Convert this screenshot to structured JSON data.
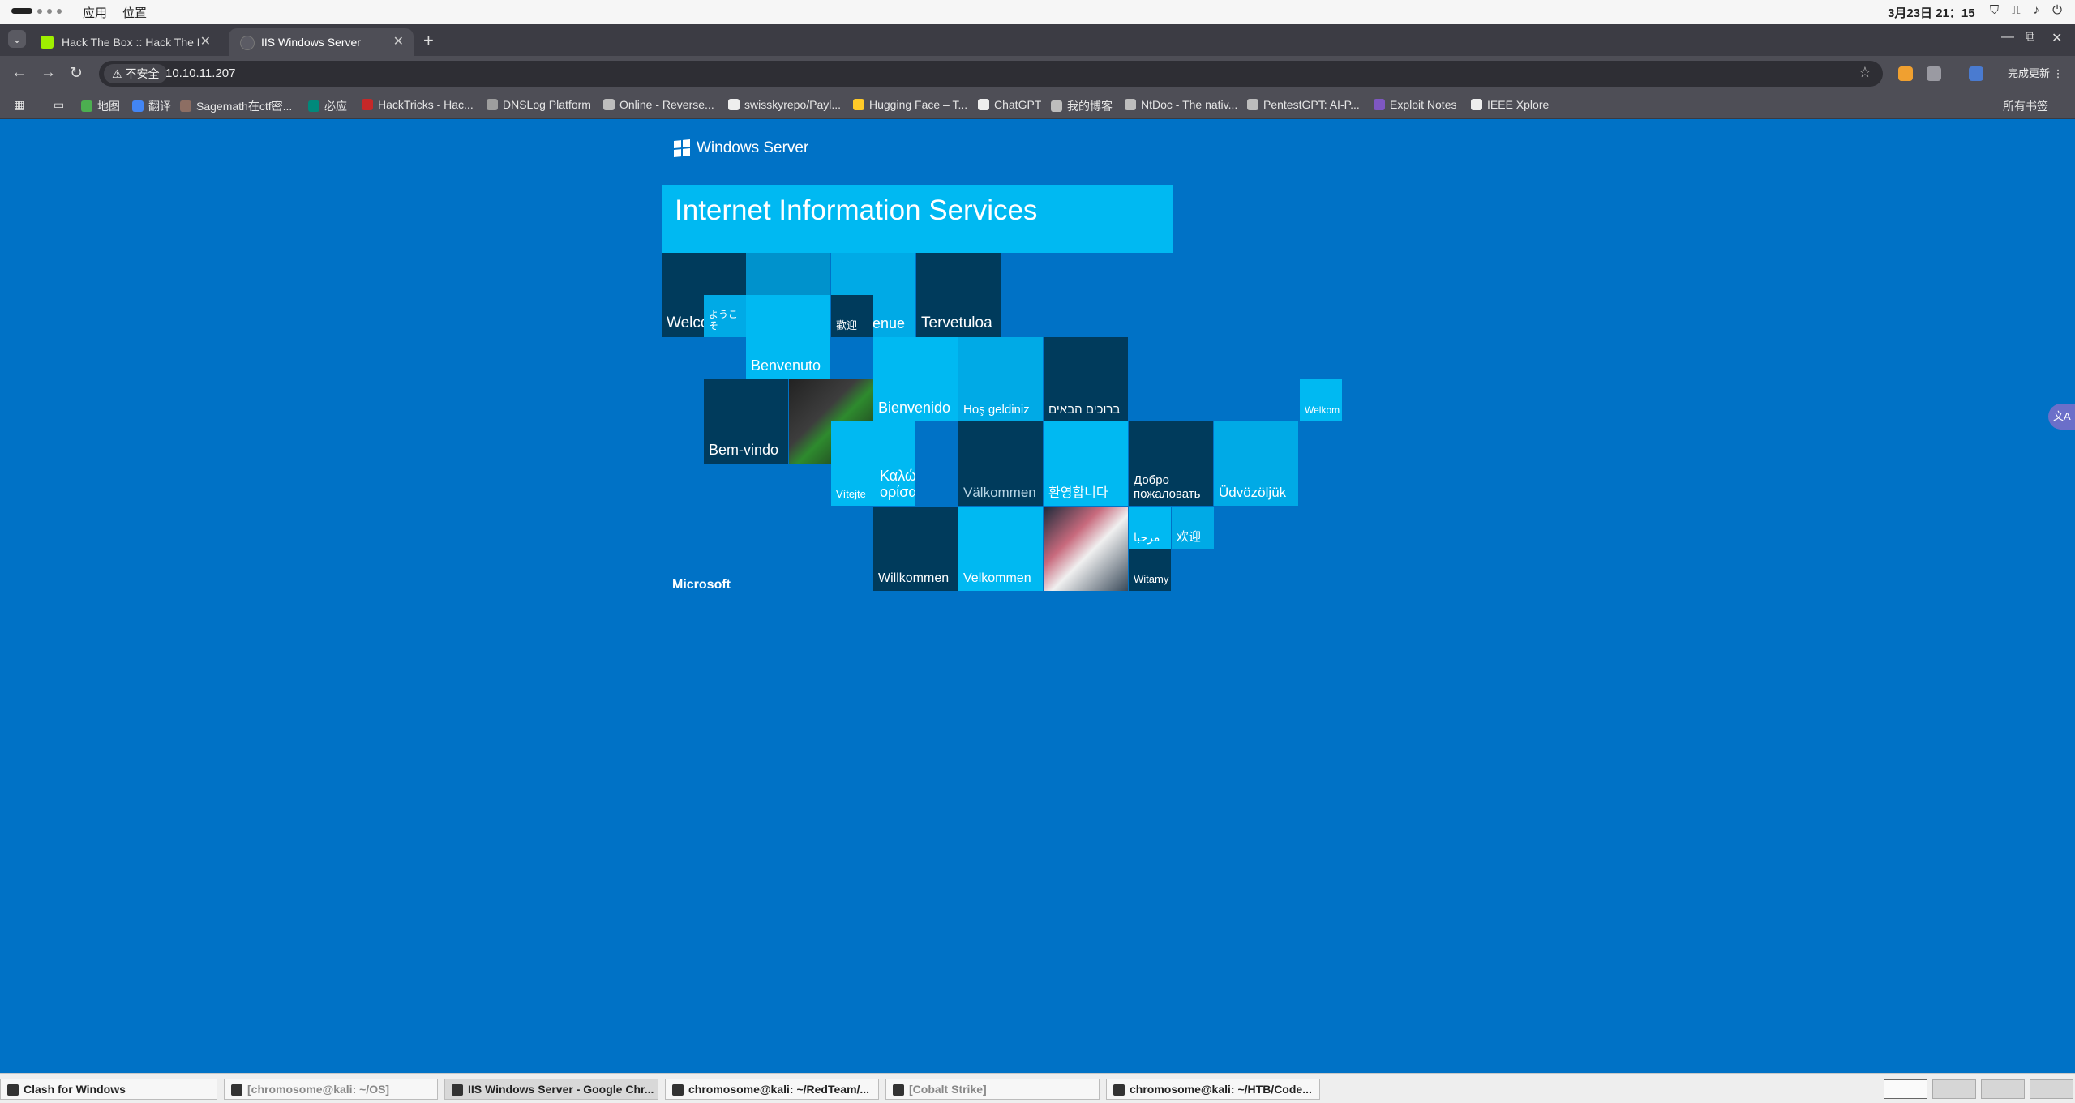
{
  "topbar": {
    "apps_menu": "应用",
    "places_menu": "位置",
    "clock": "3月23日  21：15"
  },
  "tabs": [
    {
      "title": "Hack The Box :: Hack The B",
      "close": "✕"
    },
    {
      "title": "IIS Windows Server",
      "close": "✕"
    }
  ],
  "toolbar": {
    "new_tab": "+",
    "back": "←",
    "forward": "→",
    "reload": "↻",
    "minimize": "—",
    "maximize": "⧉",
    "close": "✕"
  },
  "omnibox": {
    "security_label": "⚠ 不安全",
    "url": "10.10.11.207",
    "star": "☆"
  },
  "finish_update": "完成更新  ⋮",
  "bookmarks": [
    {
      "label": "地图",
      "color": "#4caf50"
    },
    {
      "label": "翻译",
      "color": "#4285f4"
    },
    {
      "label": "Sagemath在ctf密...",
      "color": "#8d6e63"
    },
    {
      "label": "必应",
      "color": "#00897b"
    },
    {
      "label": "HackTricks - Hac...",
      "color": "#c62828"
    },
    {
      "label": "DNSLog Platform",
      "color": "#9e9e9e"
    },
    {
      "label": "Online - Reverse...",
      "color": "#bdbdbd"
    },
    {
      "label": "swisskyrepo/Payl...",
      "color": "#eeeeee"
    },
    {
      "label": "Hugging Face – T...",
      "color": "#ffca28"
    },
    {
      "label": "ChatGPT",
      "color": "#eeeeee"
    },
    {
      "label": "我的博客",
      "color": "#bdbdbd"
    },
    {
      "label": "NtDoc - The nativ...",
      "color": "#bdbdbd"
    },
    {
      "label": "PentestGPT: AI-P...",
      "color": "#bdbdbd"
    },
    {
      "label": "Exploit Notes",
      "color": "#7e57c2"
    },
    {
      "label": "IEEE Xplore",
      "color": "#eeeeee"
    }
  ],
  "all_bookmarks": "所有书签",
  "iis": {
    "logo_text": "Windows Server",
    "banner": "Internet Information Services",
    "microsoft": "Microsoft",
    "tiles": {
      "welcome": "Welcome",
      "bienvenue": "Bienvenue",
      "tervetuloa": "Tervetuloa",
      "youkoso": "ようこそ",
      "benvenuto": "Benvenuto",
      "kangei_trad": "歡迎",
      "bienvenido": "Bienvenido",
      "hos_geldiniz": "Hoş geldiniz",
      "hebrew": "ברוכים הבאים",
      "welkom": "Welkom",
      "bem_vindo": "Bem-vindo",
      "kalos": "Καλώς ορίσατε",
      "vitejte": "Vítejte",
      "valkommen": "Välkommen",
      "korean": "환영합니다",
      "dobro": "Добро пожаловать",
      "udvozoljuk": "Üdvözöljük",
      "arabic": "مرحبا",
      "huanying": "欢迎",
      "willkommen": "Willkommen",
      "velkommen": "Velkommen",
      "witamy": "Witamy"
    }
  },
  "taskbar": [
    {
      "label": "Clash for Windows"
    },
    {
      "label": "[chromosome@kali: ~/OS]"
    },
    {
      "label": "IIS Windows Server - Google Chr..."
    },
    {
      "label": "chromosome@kali: ~/RedTeam/..."
    },
    {
      "label": "[Cobalt Strike]"
    },
    {
      "label": "chromosome@kali: ~/HTB/Code..."
    }
  ]
}
